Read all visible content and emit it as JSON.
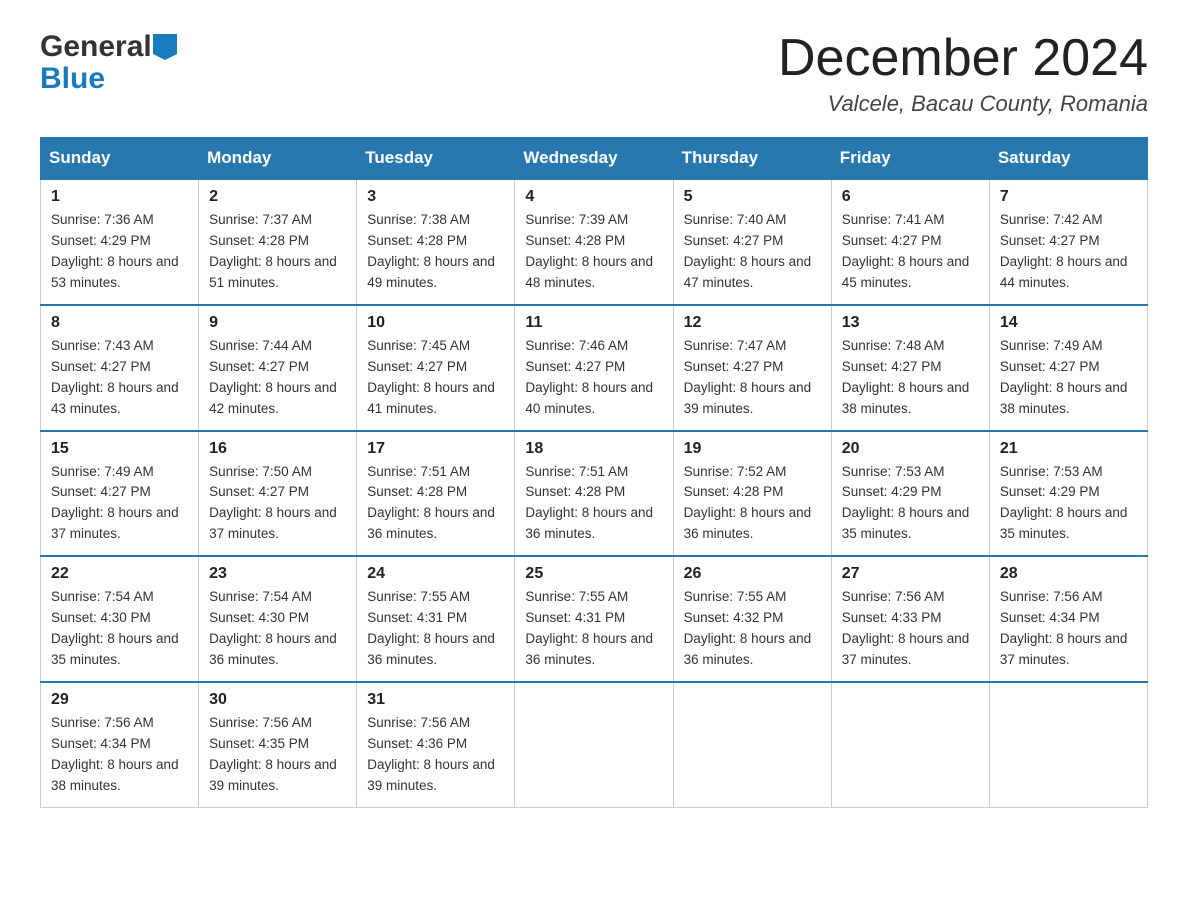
{
  "header": {
    "logo_general": "General",
    "logo_blue": "Blue",
    "month_title": "December 2024",
    "location": "Valcele, Bacau County, Romania"
  },
  "days_of_week": [
    "Sunday",
    "Monday",
    "Tuesday",
    "Wednesday",
    "Thursday",
    "Friday",
    "Saturday"
  ],
  "weeks": [
    [
      {
        "num": "1",
        "sunrise": "7:36 AM",
        "sunset": "4:29 PM",
        "daylight": "8 hours and 53 minutes."
      },
      {
        "num": "2",
        "sunrise": "7:37 AM",
        "sunset": "4:28 PM",
        "daylight": "8 hours and 51 minutes."
      },
      {
        "num": "3",
        "sunrise": "7:38 AM",
        "sunset": "4:28 PM",
        "daylight": "8 hours and 49 minutes."
      },
      {
        "num": "4",
        "sunrise": "7:39 AM",
        "sunset": "4:28 PM",
        "daylight": "8 hours and 48 minutes."
      },
      {
        "num": "5",
        "sunrise": "7:40 AM",
        "sunset": "4:27 PM",
        "daylight": "8 hours and 47 minutes."
      },
      {
        "num": "6",
        "sunrise": "7:41 AM",
        "sunset": "4:27 PM",
        "daylight": "8 hours and 45 minutes."
      },
      {
        "num": "7",
        "sunrise": "7:42 AM",
        "sunset": "4:27 PM",
        "daylight": "8 hours and 44 minutes."
      }
    ],
    [
      {
        "num": "8",
        "sunrise": "7:43 AM",
        "sunset": "4:27 PM",
        "daylight": "8 hours and 43 minutes."
      },
      {
        "num": "9",
        "sunrise": "7:44 AM",
        "sunset": "4:27 PM",
        "daylight": "8 hours and 42 minutes."
      },
      {
        "num": "10",
        "sunrise": "7:45 AM",
        "sunset": "4:27 PM",
        "daylight": "8 hours and 41 minutes."
      },
      {
        "num": "11",
        "sunrise": "7:46 AM",
        "sunset": "4:27 PM",
        "daylight": "8 hours and 40 minutes."
      },
      {
        "num": "12",
        "sunrise": "7:47 AM",
        "sunset": "4:27 PM",
        "daylight": "8 hours and 39 minutes."
      },
      {
        "num": "13",
        "sunrise": "7:48 AM",
        "sunset": "4:27 PM",
        "daylight": "8 hours and 38 minutes."
      },
      {
        "num": "14",
        "sunrise": "7:49 AM",
        "sunset": "4:27 PM",
        "daylight": "8 hours and 38 minutes."
      }
    ],
    [
      {
        "num": "15",
        "sunrise": "7:49 AM",
        "sunset": "4:27 PM",
        "daylight": "8 hours and 37 minutes."
      },
      {
        "num": "16",
        "sunrise": "7:50 AM",
        "sunset": "4:27 PM",
        "daylight": "8 hours and 37 minutes."
      },
      {
        "num": "17",
        "sunrise": "7:51 AM",
        "sunset": "4:28 PM",
        "daylight": "8 hours and 36 minutes."
      },
      {
        "num": "18",
        "sunrise": "7:51 AM",
        "sunset": "4:28 PM",
        "daylight": "8 hours and 36 minutes."
      },
      {
        "num": "19",
        "sunrise": "7:52 AM",
        "sunset": "4:28 PM",
        "daylight": "8 hours and 36 minutes."
      },
      {
        "num": "20",
        "sunrise": "7:53 AM",
        "sunset": "4:29 PM",
        "daylight": "8 hours and 35 minutes."
      },
      {
        "num": "21",
        "sunrise": "7:53 AM",
        "sunset": "4:29 PM",
        "daylight": "8 hours and 35 minutes."
      }
    ],
    [
      {
        "num": "22",
        "sunrise": "7:54 AM",
        "sunset": "4:30 PM",
        "daylight": "8 hours and 35 minutes."
      },
      {
        "num": "23",
        "sunrise": "7:54 AM",
        "sunset": "4:30 PM",
        "daylight": "8 hours and 36 minutes."
      },
      {
        "num": "24",
        "sunrise": "7:55 AM",
        "sunset": "4:31 PM",
        "daylight": "8 hours and 36 minutes."
      },
      {
        "num": "25",
        "sunrise": "7:55 AM",
        "sunset": "4:31 PM",
        "daylight": "8 hours and 36 minutes."
      },
      {
        "num": "26",
        "sunrise": "7:55 AM",
        "sunset": "4:32 PM",
        "daylight": "8 hours and 36 minutes."
      },
      {
        "num": "27",
        "sunrise": "7:56 AM",
        "sunset": "4:33 PM",
        "daylight": "8 hours and 37 minutes."
      },
      {
        "num": "28",
        "sunrise": "7:56 AM",
        "sunset": "4:34 PM",
        "daylight": "8 hours and 37 minutes."
      }
    ],
    [
      {
        "num": "29",
        "sunrise": "7:56 AM",
        "sunset": "4:34 PM",
        "daylight": "8 hours and 38 minutes."
      },
      {
        "num": "30",
        "sunrise": "7:56 AM",
        "sunset": "4:35 PM",
        "daylight": "8 hours and 39 minutes."
      },
      {
        "num": "31",
        "sunrise": "7:56 AM",
        "sunset": "4:36 PM",
        "daylight": "8 hours and 39 minutes."
      },
      null,
      null,
      null,
      null
    ]
  ]
}
